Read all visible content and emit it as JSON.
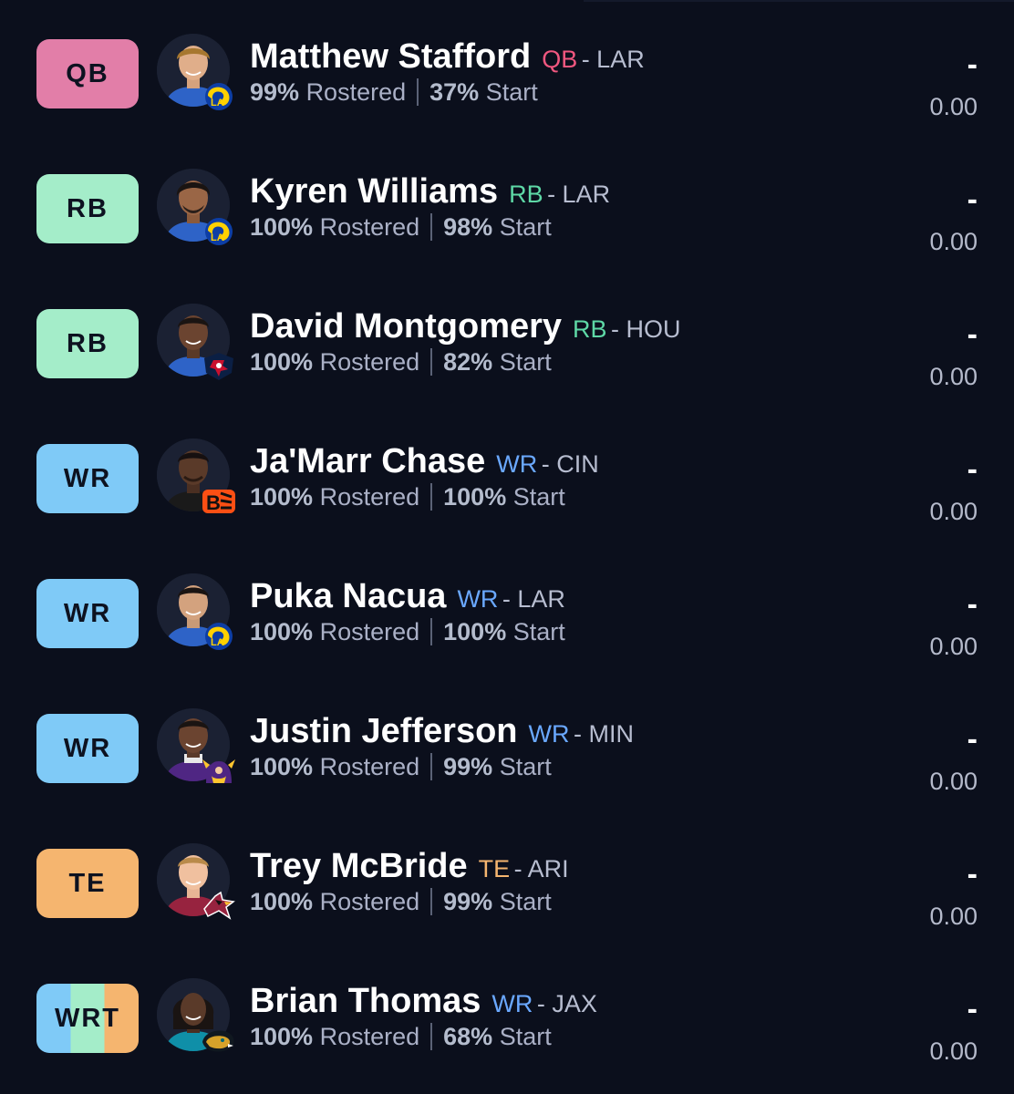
{
  "colors": {
    "background": "#0b0f1c",
    "qb": "#e27ea8",
    "rb": "#a4edc9",
    "wr": "#7fcaf7",
    "te": "#f5b56f"
  },
  "players": [
    {
      "slot": "QB",
      "name": "Matthew Stafford",
      "position": "QB",
      "team": "- LAR",
      "rostered_pct": "99%",
      "rostered_label": "Rostered",
      "start_pct": "37%",
      "start_label": "Start",
      "projection": "-",
      "points": "0.00",
      "team_icon": "rams-logo-icon"
    },
    {
      "slot": "RB",
      "name": "Kyren Williams",
      "position": "RB",
      "team": "- LAR",
      "rostered_pct": "100%",
      "rostered_label": "Rostered",
      "start_pct": "98%",
      "start_label": "Start",
      "projection": "-",
      "points": "0.00",
      "team_icon": "rams-logo-icon"
    },
    {
      "slot": "RB",
      "name": "David Montgomery",
      "position": "RB",
      "team": "- HOU",
      "rostered_pct": "100%",
      "rostered_label": "Rostered",
      "start_pct": "82%",
      "start_label": "Start",
      "projection": "-",
      "points": "0.00",
      "team_icon": "texans-logo-icon"
    },
    {
      "slot": "WR",
      "name": "Ja'Marr Chase",
      "position": "WR",
      "team": "- CIN",
      "rostered_pct": "100%",
      "rostered_label": "Rostered",
      "start_pct": "100%",
      "start_label": "Start",
      "projection": "-",
      "points": "0.00",
      "team_icon": "bengals-logo-icon"
    },
    {
      "slot": "WR",
      "name": "Puka Nacua",
      "position": "WR",
      "team": "- LAR",
      "rostered_pct": "100%",
      "rostered_label": "Rostered",
      "start_pct": "100%",
      "start_label": "Start",
      "projection": "-",
      "points": "0.00",
      "team_icon": "rams-logo-icon"
    },
    {
      "slot": "WR",
      "name": "Justin Jefferson",
      "position": "WR",
      "team": "- MIN",
      "rostered_pct": "100%",
      "rostered_label": "Rostered",
      "start_pct": "99%",
      "start_label": "Start",
      "projection": "-",
      "points": "0.00",
      "team_icon": "vikings-logo-icon"
    },
    {
      "slot": "TE",
      "name": "Trey McBride",
      "position": "TE",
      "team": "- ARI",
      "rostered_pct": "100%",
      "rostered_label": "Rostered",
      "start_pct": "99%",
      "start_label": "Start",
      "projection": "-",
      "points": "0.00",
      "team_icon": "cardinals-logo-icon"
    },
    {
      "slot": "WRT",
      "name": "Brian Thomas",
      "position": "WR",
      "team": "- JAX",
      "rostered_pct": "100%",
      "rostered_label": "Rostered",
      "start_pct": "68%",
      "start_label": "Start",
      "projection": "-",
      "points": "0.00",
      "team_icon": "jaguars-logo-icon"
    }
  ]
}
